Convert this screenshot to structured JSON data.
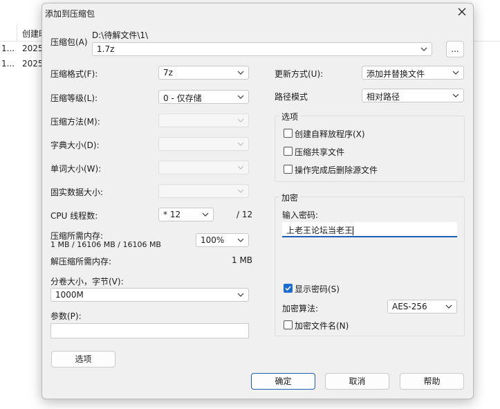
{
  "background": {
    "column_header": "创建时",
    "rows": [
      {
        "col1": "1...",
        "col2": "2025"
      },
      {
        "col1": "1...",
        "col2": "2025"
      }
    ]
  },
  "dialog": {
    "title": "添加到压缩包",
    "archive_label": "压缩包(A)",
    "archive_path": "D:\\待解文件\\1\\",
    "archive_name": "1.7z",
    "browse_label": "...",
    "format_label": "压缩格式(F):",
    "format_value": "7z",
    "level_label": "压缩等级(L):",
    "level_value": "0 - 仅存储",
    "method_label": "压缩方法(M):",
    "dict_label": "字典大小(D):",
    "word_label": "单词大小(W):",
    "solid_label": "固实数据大小:",
    "cpu_label": "CPU 线程数:",
    "cpu_value": "* 12",
    "cpu_max": "/ 12",
    "mem_label": "压缩所需内存:",
    "mem_value": "1 MB / 16106 MB / 16106 MB",
    "mem_percent": "100%",
    "decomp_label": "解压缩所需内存:",
    "decomp_value": "1 MB",
    "volume_label": "分卷大小，字节(V):",
    "volume_value": "1000M",
    "params_label": "参数(P):",
    "params_value": "",
    "options_button": "选项",
    "update_label": "更新方式(U):",
    "update_value": "添加并替换文件",
    "path_label": "路径模式",
    "path_value": "相对路径",
    "options_group": {
      "title": "选项",
      "sfx": "创建自释放程序(X)",
      "shared": "压缩共享文件",
      "delete": "操作完成后删除源文件"
    },
    "encrypt_group": {
      "title": "加密",
      "password_label": "输入密码:",
      "password_value": "上老王论坛当老王",
      "show_password": "显示密码(S)",
      "method_label": "加密算法:",
      "method_value": "AES-256",
      "encrypt_names": "加密文件名(N)"
    },
    "ok_button": "确定",
    "cancel_button": "取消",
    "help_button": "帮助"
  }
}
